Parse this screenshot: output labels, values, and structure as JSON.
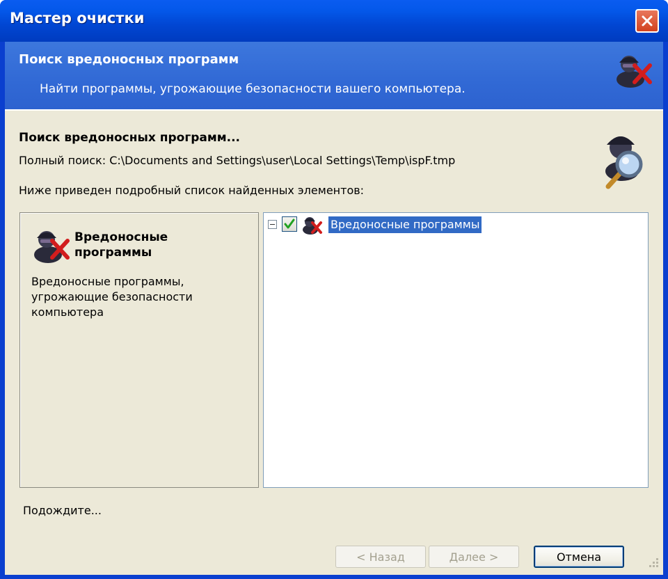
{
  "window": {
    "title": "Мастер очистки"
  },
  "header": {
    "title": "Поиск вредоносных программ",
    "subtitle": "Найти программы, угрожающие безопасности вашего компьютера.",
    "icon": "malware-spy-icon"
  },
  "content": {
    "heading": "Поиск вредоносных программ...",
    "scan_path": "Полный поиск: C:\\Documents and Settings\\user\\Local Settings\\Temp\\ispF.tmp",
    "list_caption": "Ниже приведен подробный список найденных элементов:",
    "icon": "magnifier-spy-icon"
  },
  "info_panel": {
    "title": "Вредоносные программы",
    "description": "Вредоносные программы, угрожающие безопасности компьютера"
  },
  "tree": {
    "items": [
      {
        "label": "Вредоносные программы",
        "checked": true,
        "expanded": true,
        "selected": true
      }
    ]
  },
  "status": {
    "text": "Подождите..."
  },
  "buttons": {
    "back": "< Назад",
    "next": "Далее >",
    "cancel": "Отмена"
  },
  "colors": {
    "title_bar": "#0458ea",
    "header_band": "#3169d5",
    "dialog_bg": "#ece9d8",
    "selection": "#316ac5",
    "close_button": "#d2421e"
  }
}
